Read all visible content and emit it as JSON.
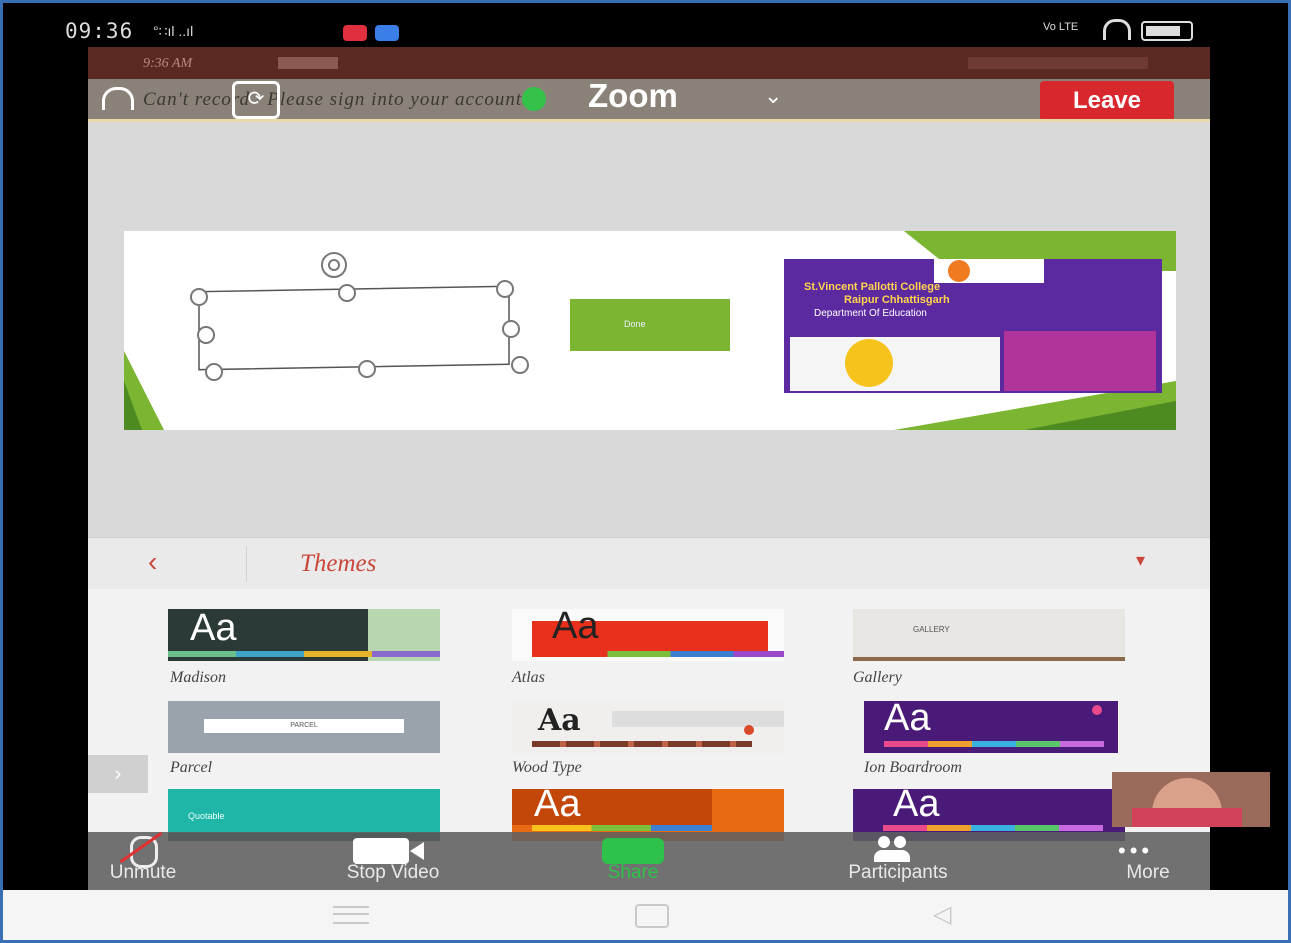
{
  "status_bar": {
    "time": "09:36",
    "signal_text": "°∷ıl ..ıl",
    "volte": "Vo LTE"
  },
  "notification_shade": {
    "time": "9:36 AM"
  },
  "zoom": {
    "title": "Zoom",
    "banner_text": "Can't record · Please sign into your account.",
    "leave_label": "Leave",
    "accent": "#d8282e"
  },
  "slide": {
    "poster_title_line1": "St.Vincent Pallotti College",
    "poster_title_line2": "Raipur Chhattisgarh",
    "poster_dept": "Department Of Education",
    "poster_green_box": "Done"
  },
  "themes_panel": {
    "title": "Themes",
    "items": [
      {
        "name": "Madison",
        "sample": "Aa"
      },
      {
        "name": "Atlas",
        "sample": "Aa"
      },
      {
        "name": "Gallery",
        "sample": "GALLERY"
      },
      {
        "name": "Parcel",
        "sample": "PARCEL"
      },
      {
        "name": "Wood Type",
        "sample": "Aa"
      },
      {
        "name": "Ion Boardroom",
        "sample": "Aa"
      },
      {
        "name": "Quotable",
        "sample": "Quotable"
      },
      {
        "name": "",
        "sample": "Aa"
      },
      {
        "name": "",
        "sample": "Aa"
      }
    ]
  },
  "toolbar": {
    "unmute": "Unmute",
    "stop_video": "Stop Video",
    "share": "Share",
    "participants": "Participants",
    "more": "More"
  }
}
